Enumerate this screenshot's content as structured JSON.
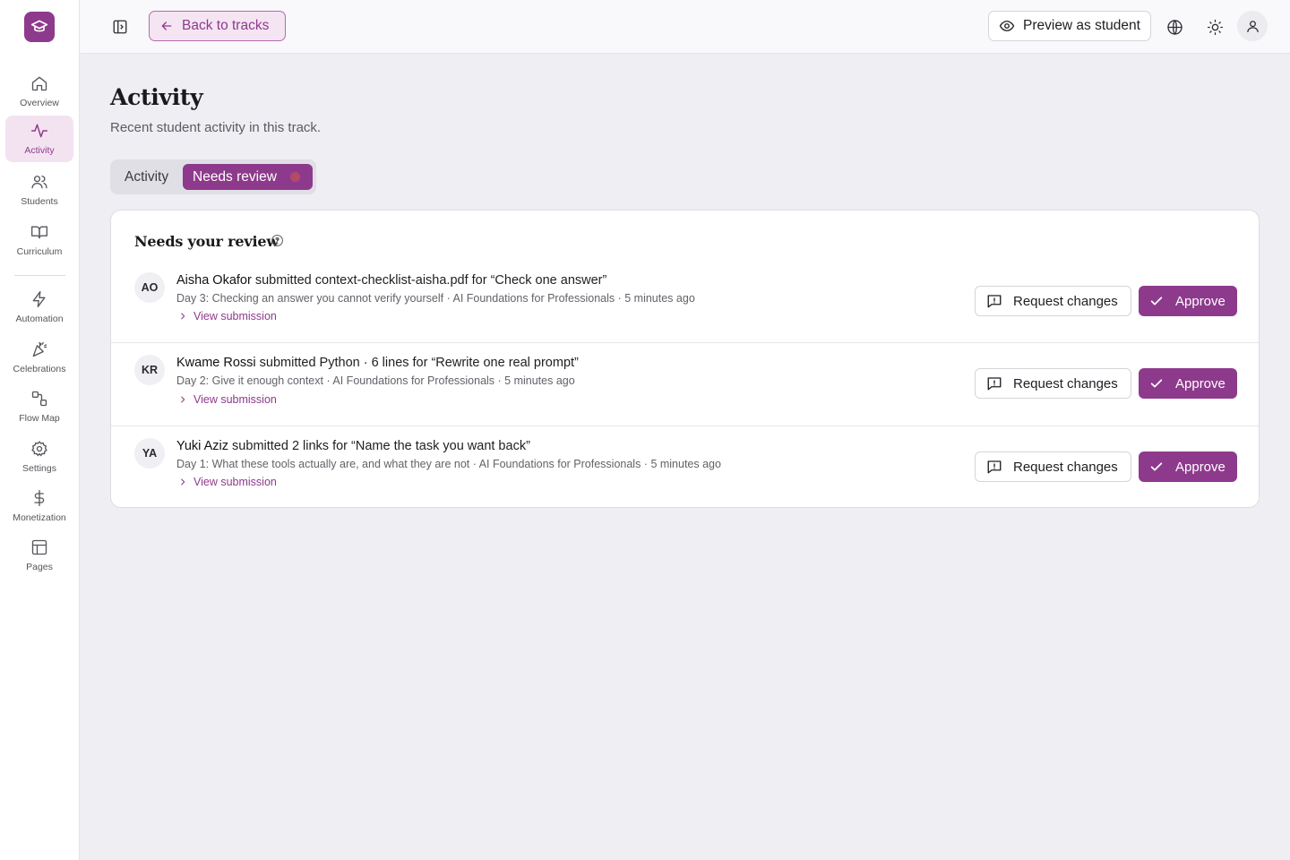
{
  "sidebar": {
    "logo_icon": "graduation-cap-icon",
    "items": [
      {
        "label": "Overview",
        "icon": "home-icon"
      },
      {
        "label": "Activity",
        "icon": "activity-icon",
        "active": true
      },
      {
        "label": "Students",
        "icon": "users-icon"
      },
      {
        "label": "Curriculum",
        "icon": "book-icon"
      },
      {
        "label": "Automation",
        "icon": "lightning-icon"
      },
      {
        "label": "Celebrations",
        "icon": "party-icon"
      },
      {
        "label": "Flow Map",
        "icon": "flow-icon"
      },
      {
        "label": "Settings",
        "icon": "gear-icon"
      },
      {
        "label": "Monetization",
        "icon": "dollar-icon"
      },
      {
        "label": "Pages",
        "icon": "layout-icon"
      }
    ]
  },
  "topbar": {
    "back_label": "Back to tracks",
    "preview_label": "Preview as student"
  },
  "page": {
    "title": "Activity",
    "subtitle": "Recent student activity in this track."
  },
  "tabs": [
    {
      "label": "Activity",
      "selected": false
    },
    {
      "label": "Needs review",
      "selected": true
    }
  ],
  "review": {
    "title": "Needs your review",
    "request_label": "Request changes",
    "approve_label": "Approve",
    "link_label": "View submission",
    "items": [
      {
        "initials": "AO",
        "student": "Aisha Okafor",
        "action": " submitted context-checklist-aisha.pdf for “Check one answer”",
        "meta": "Day 3: Checking an answer you cannot verify yourself · AI Foundations for Professionals · 5 minutes ago"
      },
      {
        "initials": "KR",
        "student": "Kwame Rossi",
        "action": " submitted Python · 6 lines for “Rewrite one real prompt”",
        "meta": "Day 2: Give it enough context · AI Foundations for Professionals · 5 minutes ago"
      },
      {
        "initials": "YA",
        "student": "Yuki Aziz",
        "action": " submitted 2 links for “Name the task you want back”",
        "meta": "Day 1: What these tools actually are, and what they are not · AI Foundations for Professionals · 5 minutes ago"
      }
    ]
  },
  "colors": {
    "accent": "#8e3a8c",
    "accent_light": "#f3e3f1",
    "background": "#efeef3"
  }
}
